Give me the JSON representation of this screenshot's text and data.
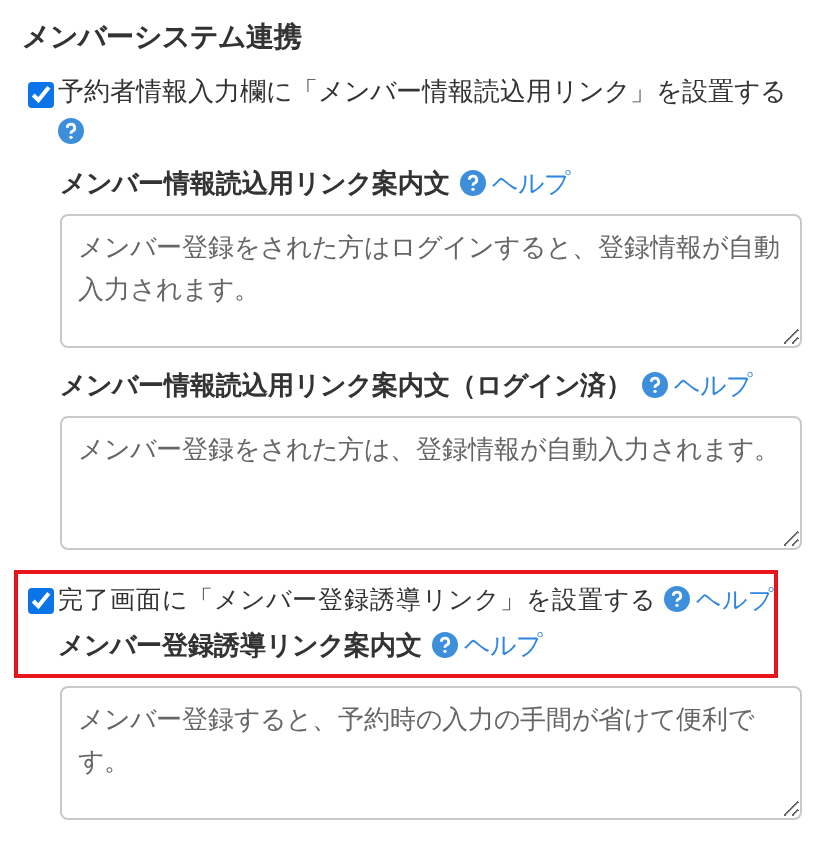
{
  "section_title": "メンバーシステム連携",
  "items": [
    {
      "kind": "checkbox",
      "label": "予約者情報入力欄に「メンバー情報読込用リンク」を設置する",
      "checked": true,
      "highlighted": false
    },
    {
      "kind": "label",
      "label": "メンバー情報読込用リンク案内文",
      "help": "ヘルプ",
      "highlighted": false
    },
    {
      "kind": "textarea",
      "value": "メンバー登録をされた方はログインすると、登録情報が自動入力されます。",
      "highlighted": false
    },
    {
      "kind": "label",
      "label": "メンバー情報読込用リンク案内文（ログイン済）",
      "help": "ヘルプ",
      "highlighted": false
    },
    {
      "kind": "textarea",
      "value": "メンバー登録をされた方は、登録情報が自動入力されます。",
      "highlighted": false
    },
    {
      "kind": "checkbox",
      "label": "完了画面に「メンバー登録誘導リンク」を設置する",
      "checked": true,
      "help": "ヘルプ",
      "highlighted": true
    },
    {
      "kind": "label",
      "label": "メンバー登録誘導リンク案内文",
      "help": "ヘルプ",
      "highlighted": true
    },
    {
      "kind": "textarea",
      "value": "メンバー登録すると、予約時の入力の手間が省けて便利です。",
      "highlighted": false
    }
  ]
}
